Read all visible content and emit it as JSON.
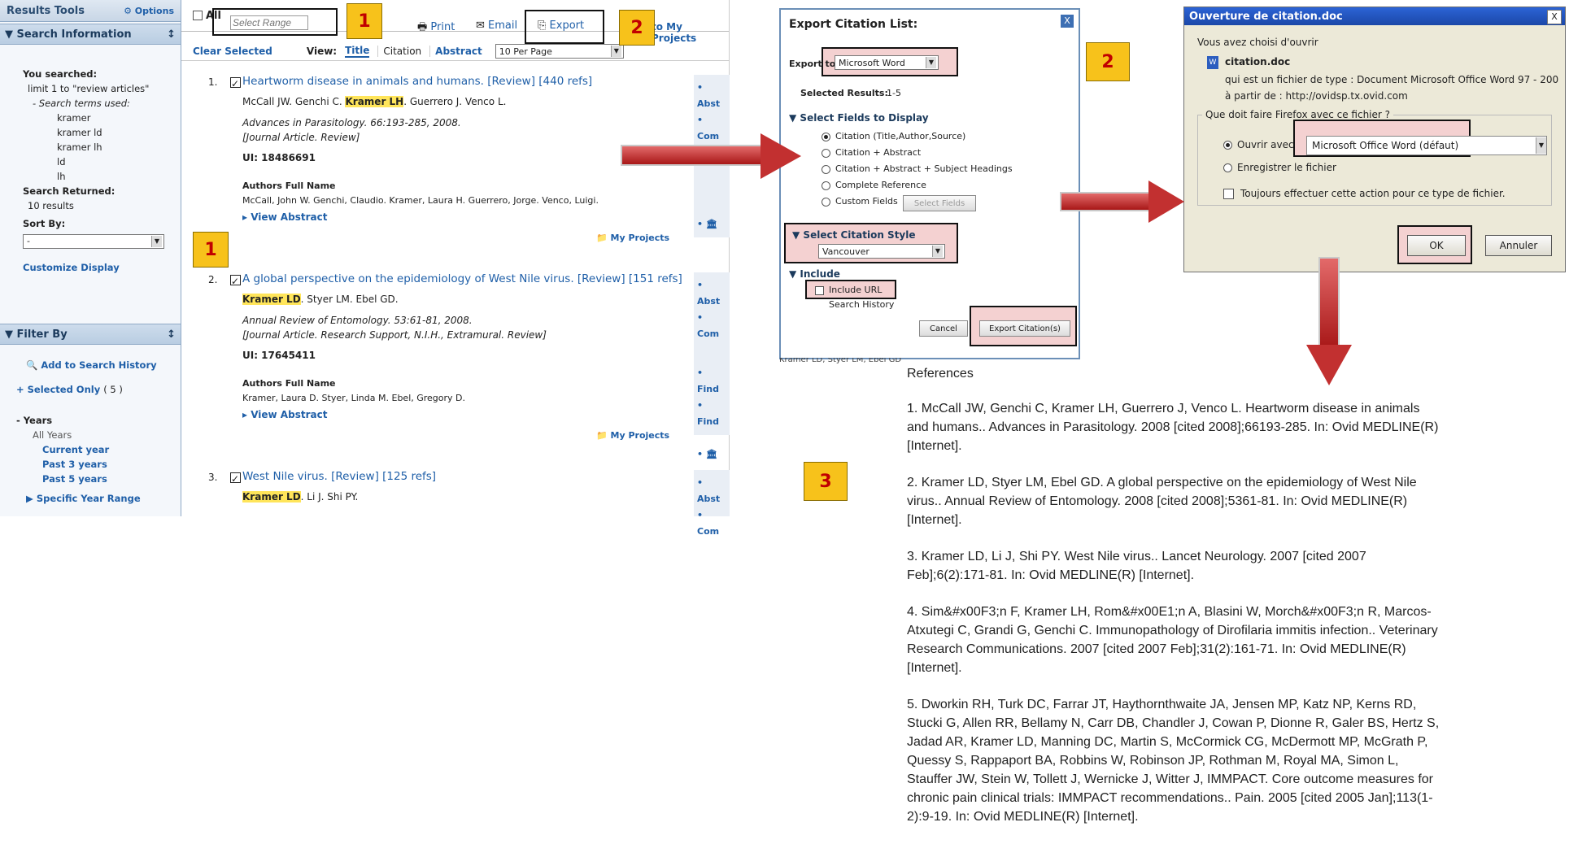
{
  "panel1": {
    "sidebar": {
      "results_tools": "Results Tools",
      "options": "Options",
      "search_information": "Search Information",
      "you_searched": "You searched:",
      "query": "limit 1 to \"review articles\"",
      "search_terms_label": "- Search terms used:",
      "terms": [
        "kramer",
        "kramer ld",
        "kramer lh",
        "ld",
        "lh"
      ],
      "search_returned": "Search Returned:",
      "results_count": "10 results",
      "sort_by": "Sort By:",
      "sort_value": "-",
      "customize": "Customize Display",
      "filter_by": "Filter By",
      "add_history": "Add to Search History",
      "selected_only": "+ Selected Only",
      "selected_count": "( 5 )",
      "years": "- Years",
      "all_years": "All Years",
      "current_year": "Current year",
      "past3": "Past 3 years",
      "past5": "Past 5 years",
      "specific_year": "Specific Year Range"
    },
    "toolbar": {
      "all": "All",
      "select_range_placeholder": "Select Range",
      "print": "Print",
      "email": "Email",
      "export": "Export",
      "my_projects": "to My Projects"
    },
    "viewbar": {
      "clear_selected": "Clear Selected",
      "view": "View:",
      "title": "Title",
      "citation": "Citation",
      "abstract": "Abstract",
      "per_page": "10 Per Page"
    },
    "results": [
      {
        "num": "1.",
        "title": "Heartworm disease in animals and humans. [Review] [440 refs]",
        "authors_pre": "McCall JW. Genchi C.",
        "authors_hl": "Kramer LH",
        "authors_post": ". Guerrero J. Venco L.",
        "journal": "Advances in Parasitology. 66:193-285, 2008.",
        "type": "[Journal Article. Review]",
        "ui": "UI: 18486691",
        "afn_label": "Authors Full Name",
        "afn": "McCall, John W. Genchi, Claudio. Kramer, Laura H. Guerrero, Jorge. Venco, Luigi.",
        "view_abstract": "View Abstract",
        "my_projects": "My Projects",
        "side": [
          "Abst",
          "Com",
          "",
          "",
          "",
          ""
        ]
      },
      {
        "num": "2.",
        "title": "A global perspective on the epidemiology of West Nile virus. [Review] [151 refs]",
        "authors_pre": "",
        "authors_hl": "Kramer LD",
        "authors_post": ". Styer LM. Ebel GD.",
        "journal": "Annual Review of Entomology. 53:61-81, 2008.",
        "type": "[Journal Article. Research Support, N.I.H., Extramural. Review]",
        "ui": "UI: 17645411",
        "afn_label": "Authors Full Name",
        "afn": "Kramer, Laura D. Styer, Linda M. Ebel, Gregory D.",
        "view_abstract": "View Abstract",
        "my_projects": "My Projects",
        "side": [
          "Abst",
          "Com",
          "Find",
          "Find"
        ]
      },
      {
        "num": "3.",
        "title": "West Nile virus. [Review] [125 refs]",
        "authors_pre": "",
        "authors_hl": "Kramer LD",
        "authors_post": ". Li J. Shi PY.",
        "side": [
          "Abst",
          "Com"
        ]
      }
    ],
    "badges": [
      "1",
      "2",
      "1"
    ]
  },
  "dialog": {
    "title": "Export Citation List:",
    "export_to_label": "Export to",
    "export_to_value": "Microsoft Word",
    "selected_results_label": "Selected Results:",
    "selected_results_value": "1-5",
    "fields_header": "Select Fields to Display",
    "fields": [
      "Citation (Title,Author,Source)",
      "Citation + Abstract",
      "Citation + Abstract + Subject Headings",
      "Complete Reference",
      "Custom Fields"
    ],
    "select_fields_btn": "Select Fields",
    "style_header": "Select Citation Style",
    "style_value": "Vancouver",
    "include_header": "Include",
    "include_url": "Include URL",
    "search_history": "Search History",
    "cancel": "Cancel",
    "export_btn": "Export Citation(s)",
    "close": "X",
    "badge": "2",
    "bleed_text": "Kramer LD, Styer LM, Ebel GD"
  },
  "firefox": {
    "title": "Ouverture de citation.doc",
    "close": "X",
    "chose": "Vous avez choisi d'ouvrir",
    "filename": "citation.doc",
    "filetype": "qui est un fichier de type :  Document Microsoft Office Word 97 - 200",
    "from": "à partir de :  http://ovidsp.tx.ovid.com",
    "question": "Que doit faire Firefox avec ce fichier ?",
    "open_with": "Ouvrir avec",
    "open_with_value": "Microsoft Office Word (défaut)",
    "save": "Enregistrer le fichier",
    "always": "Toujours effectuer cette action pour ce type de fichier.",
    "ok": "OK",
    "cancel": "Annuler",
    "badge": "2"
  },
  "references": {
    "badge": "3",
    "heading": "References",
    "items": [
      "1. McCall JW, Genchi C, Kramer LH, Guerrero J, Venco L. Heartworm disease in animals and humans..   Advances in Parasitology. 2008 [cited 2008];66193-285. In: Ovid MEDLINE(R) [Internet].",
      "2. Kramer LD, Styer LM, Ebel GD. A global perspective on the epidemiology of West Nile virus..   Annual Review of Entomology. 2008 [cited 2008];5361-81. In: Ovid MEDLINE(R) [Internet].",
      "3. Kramer LD, Li J, Shi PY. West Nile virus..   Lancet Neurology. 2007 [cited 2007 Feb];6(2):171-81. In: Ovid MEDLINE(R) [Internet].",
      "4. Sim&#x00F3;n F, Kramer LH, Rom&#x00E1;n A, Blasini W, Morch&#x00F3;n R, Marcos-Atxutegi C, Grandi G, Genchi C. Immunopathology  of Dirofilaria immitis infection..   Veterinary Research Communications. 2007 [cited 2007 Feb];31(2):161-71. In: Ovid MEDLINE(R) [Internet].",
      "5. Dworkin RH, Turk DC, Farrar JT, Haythornthwaite JA, Jensen MP, Katz NP, Kerns RD, Stucki G, Allen RR, Bellamy N, Carr DB, Chandler J, Cowan P, Dionne R, Galer BS, Hertz S, Jadad AR, Kramer LD, Manning DC, Martin S, McCormick CG, McDermott MP, McGrath P, Quessy S, Rappaport BA, Robbins W, Robinson JP, Rothman M, Royal MA, Simon L, Stauffer JW, Stein W, Tollett J, Wernicke J, Witter J, IMMPACT. Core outcome measures for chronic pain clinical trials: IMMPACT recommendations..   Pain. 2005  [cited 2005 Jan];113(1-2):9-19. In: Ovid MEDLINE(R) [Internet]."
    ]
  }
}
